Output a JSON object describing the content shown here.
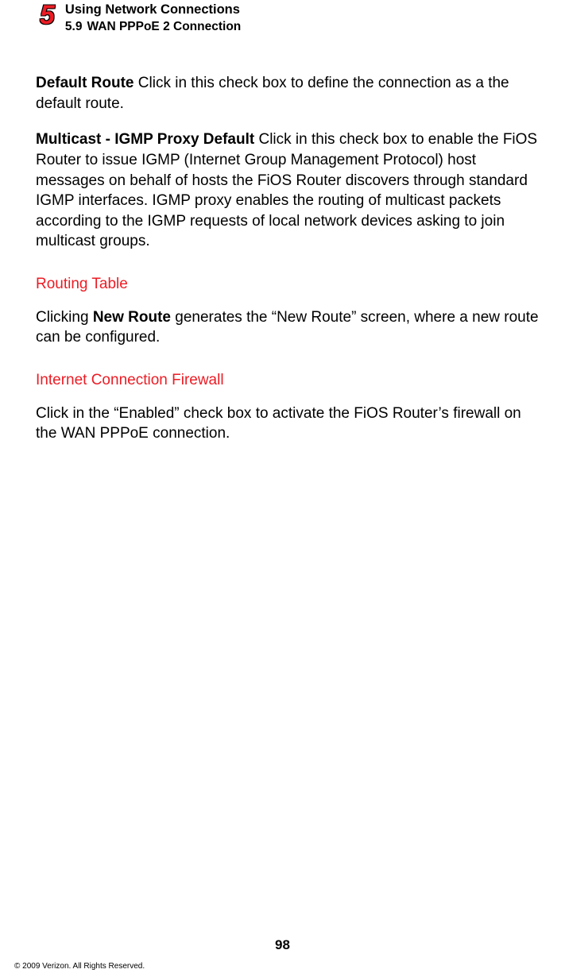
{
  "header": {
    "chapter_number": "5",
    "chapter_title": "Using Network Connections",
    "section_number": "5.9",
    "section_title": "WAN PPPoE 2 Connection"
  },
  "body": {
    "default_route_term": "Default Route",
    "default_route_text": "  Click in this check box to define the connection as a the default route.",
    "multicast_term": "Multicast - IGMP Proxy Default",
    "multicast_text": "  Click in this check box to enable the FiOS Router to issue IGMP (Internet Group Management Protocol) host messages on behalf of hosts the FiOS Router discovers through standard IGMP interfaces. IGMP proxy enables the routing of multicast packets according to the IGMP requests of local network devices asking to join multicast groups.",
    "routing_table_heading": "Routing Table",
    "routing_table_pre": "Clicking ",
    "routing_table_bold": "New Route",
    "routing_table_post": " generates the “New Route” screen, where a new route can be configured.",
    "firewall_heading": "Internet Connection Firewall",
    "firewall_text": "Click in the “Enabled” check box to activate the FiOS Router’s firewall on the WAN PPPoE connection."
  },
  "footer": {
    "page_number": "98",
    "copyright": "© 2009 Verizon. All Rights Reserved."
  }
}
